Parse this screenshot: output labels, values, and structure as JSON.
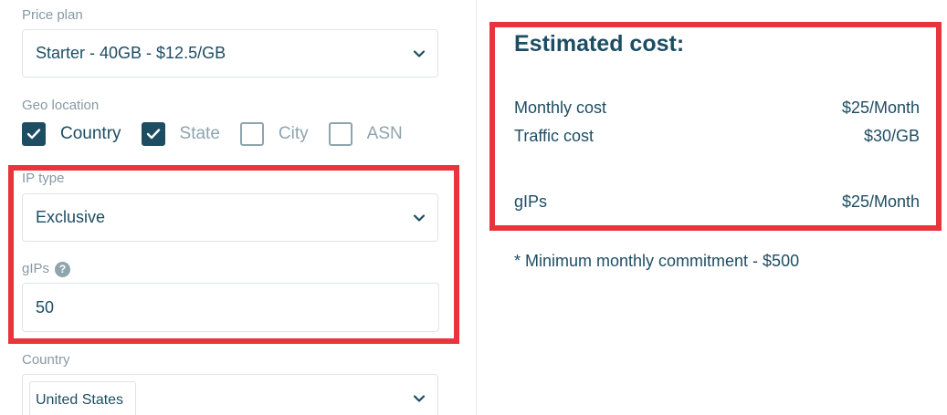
{
  "price_plan": {
    "label": "Price plan",
    "value": "Starter - 40GB - $12.5/GB"
  },
  "geo_location": {
    "label": "Geo location",
    "options": [
      {
        "label": "Country",
        "checked": true,
        "enabled": true
      },
      {
        "label": "State",
        "checked": true,
        "enabled": false
      },
      {
        "label": "City",
        "checked": false,
        "enabled": true
      },
      {
        "label": "ASN",
        "checked": false,
        "enabled": true
      }
    ]
  },
  "ip_type": {
    "label": "IP type",
    "value": "Exclusive"
  },
  "gips_field": {
    "label": "gIPs",
    "help_icon": "?",
    "value": "50"
  },
  "country": {
    "label": "Country",
    "selected_tag": "United States"
  },
  "estimate": {
    "title": "Estimated cost:",
    "rows": [
      {
        "name": "Monthly cost",
        "value": "$25/Month"
      },
      {
        "name": "Traffic cost",
        "value": "$30/GB"
      },
      {
        "name": "gIPs",
        "value": "$25/Month"
      }
    ],
    "note": "* Minimum monthly commitment - $500"
  },
  "colors": {
    "primary": "#1d4d63",
    "muted": "#8fa4ad",
    "highlight": "#e8343a",
    "border": "#dfe4e7"
  }
}
